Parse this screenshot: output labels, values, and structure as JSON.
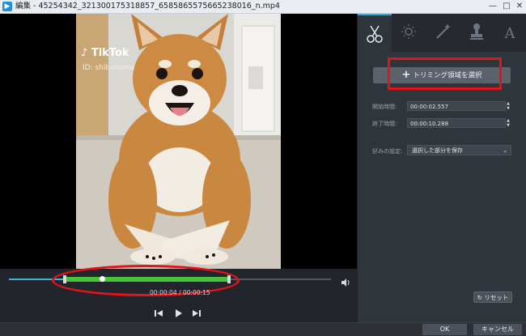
{
  "window": {
    "title": "編集 - 45254342_321300175318857_6585865575665238016_n.mp4",
    "min_glyph": "—",
    "max_glyph": "□",
    "close_glyph": "✕"
  },
  "video": {
    "watermark_brand": "TikTok",
    "watermark_id": "ID: shibakoma"
  },
  "timeline": {
    "time_display": "00:00:04 / 00:00:15",
    "played_fraction": 0.17,
    "trim_start_fraction": 0.17,
    "trim_end_fraction": 0.68,
    "playhead_fraction": 0.28
  },
  "tabs": [
    {
      "name": "trim",
      "icon": "scissors-icon",
      "active": true
    },
    {
      "name": "adjust",
      "icon": "sun-icon",
      "active": false
    },
    {
      "name": "effect",
      "icon": "magic-wand-icon",
      "active": false
    },
    {
      "name": "watermark",
      "icon": "stamp-icon",
      "active": false
    },
    {
      "name": "text",
      "icon": "text-icon",
      "active": false
    }
  ],
  "trim_panel": {
    "select_button_label": "トリミング領域を選択",
    "start_label": "開始時間:",
    "start_value": "00:00:02.557",
    "end_label": "終了時間:",
    "end_value": "00:00:10.288",
    "preference_label": "好みの設定:",
    "preference_value": "選択した部分を保存",
    "reset_label": "リセット"
  },
  "footer": {
    "ok_label": "OK",
    "cancel_label": "キャンセル"
  },
  "colors": {
    "accent": "#35a6d8",
    "trim_range": "#46c23b",
    "highlight": "#e2141a"
  }
}
